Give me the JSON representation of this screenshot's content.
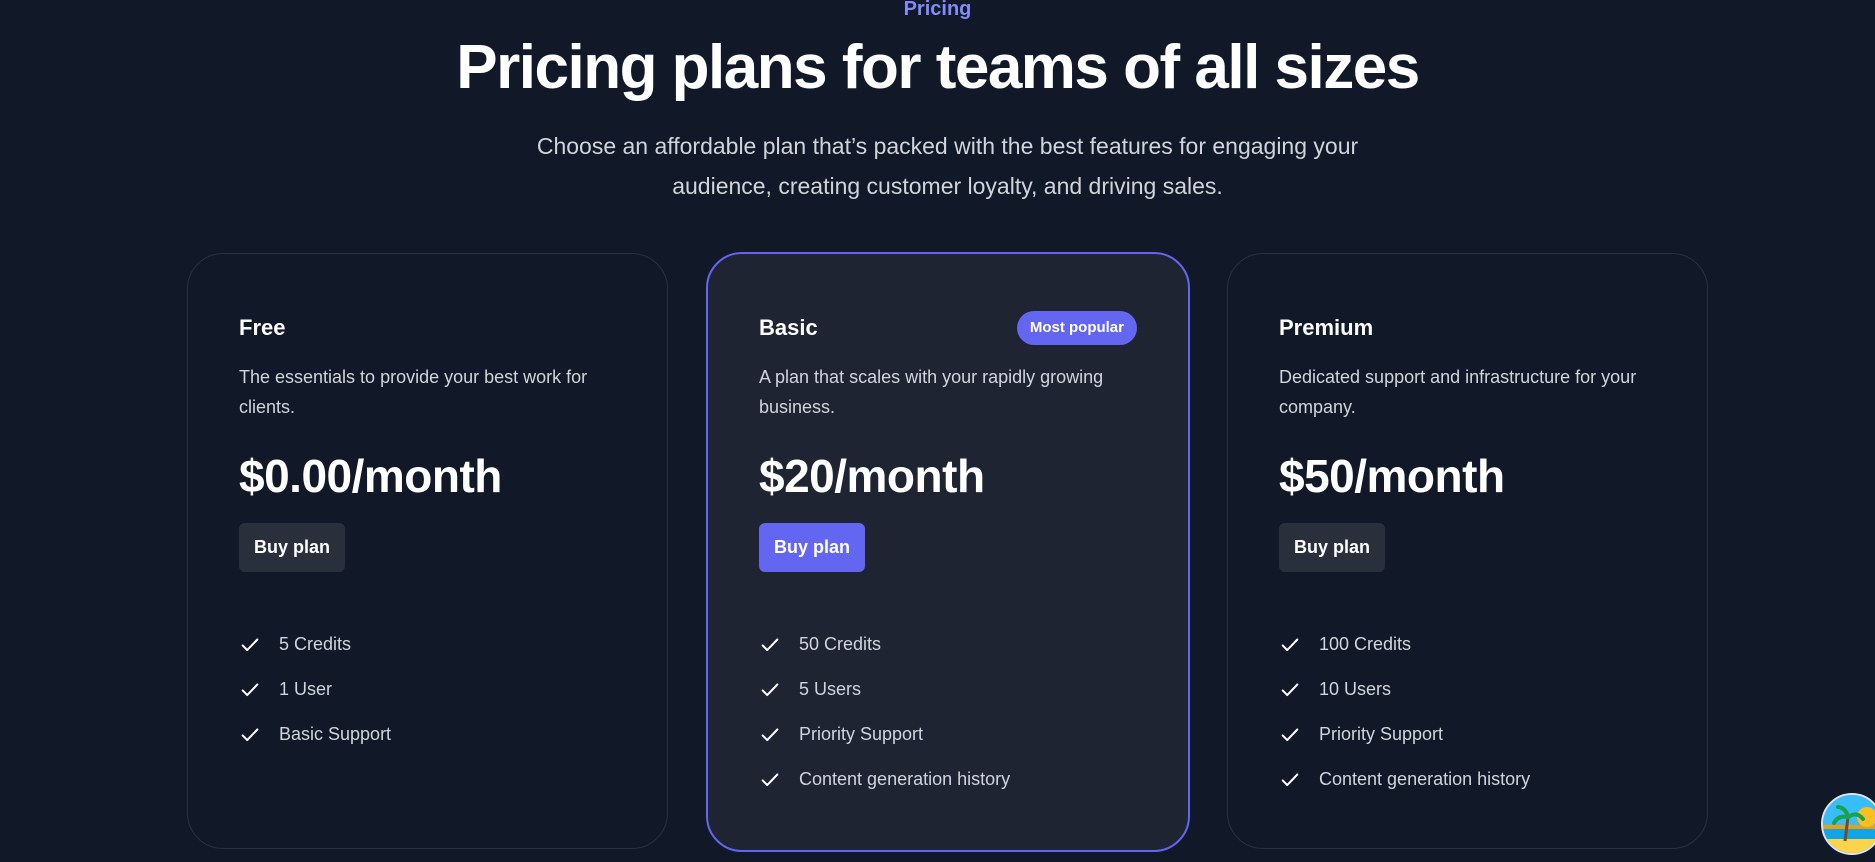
{
  "header": {
    "eyebrow": "Pricing",
    "title": "Pricing plans for teams of all sizes",
    "subtitle": "Choose an affordable plan that’s packed with the best features for engaging your audience, creating customer loyalty, and driving sales."
  },
  "plans": [
    {
      "name": "Free",
      "description": "The essentials to provide your best work for clients.",
      "price": "$0.00/month",
      "button": "Buy plan",
      "features": [
        "5 Credits",
        "1 User",
        "Basic Support"
      ]
    },
    {
      "name": "Basic",
      "badge": "Most popular",
      "description": "A plan that scales with your rapidly growing business.",
      "price": "$20/month",
      "button": "Buy plan",
      "features": [
        "50 Credits",
        "5 Users",
        "Priority Support",
        "Content generation history"
      ]
    },
    {
      "name": "Premium",
      "description": "Dedicated support and infrastructure for your company.",
      "price": "$50/month",
      "button": "Buy plan",
      "features": [
        "100 Credits",
        "10 Users",
        "Priority Support",
        "Content generation history"
      ]
    }
  ],
  "colors": {
    "background": "#111827",
    "accent": "#6366f1",
    "eyebrow": "#818cf8"
  },
  "icons": {
    "feature": "check-icon",
    "floating": "beach-avatar-icon"
  }
}
